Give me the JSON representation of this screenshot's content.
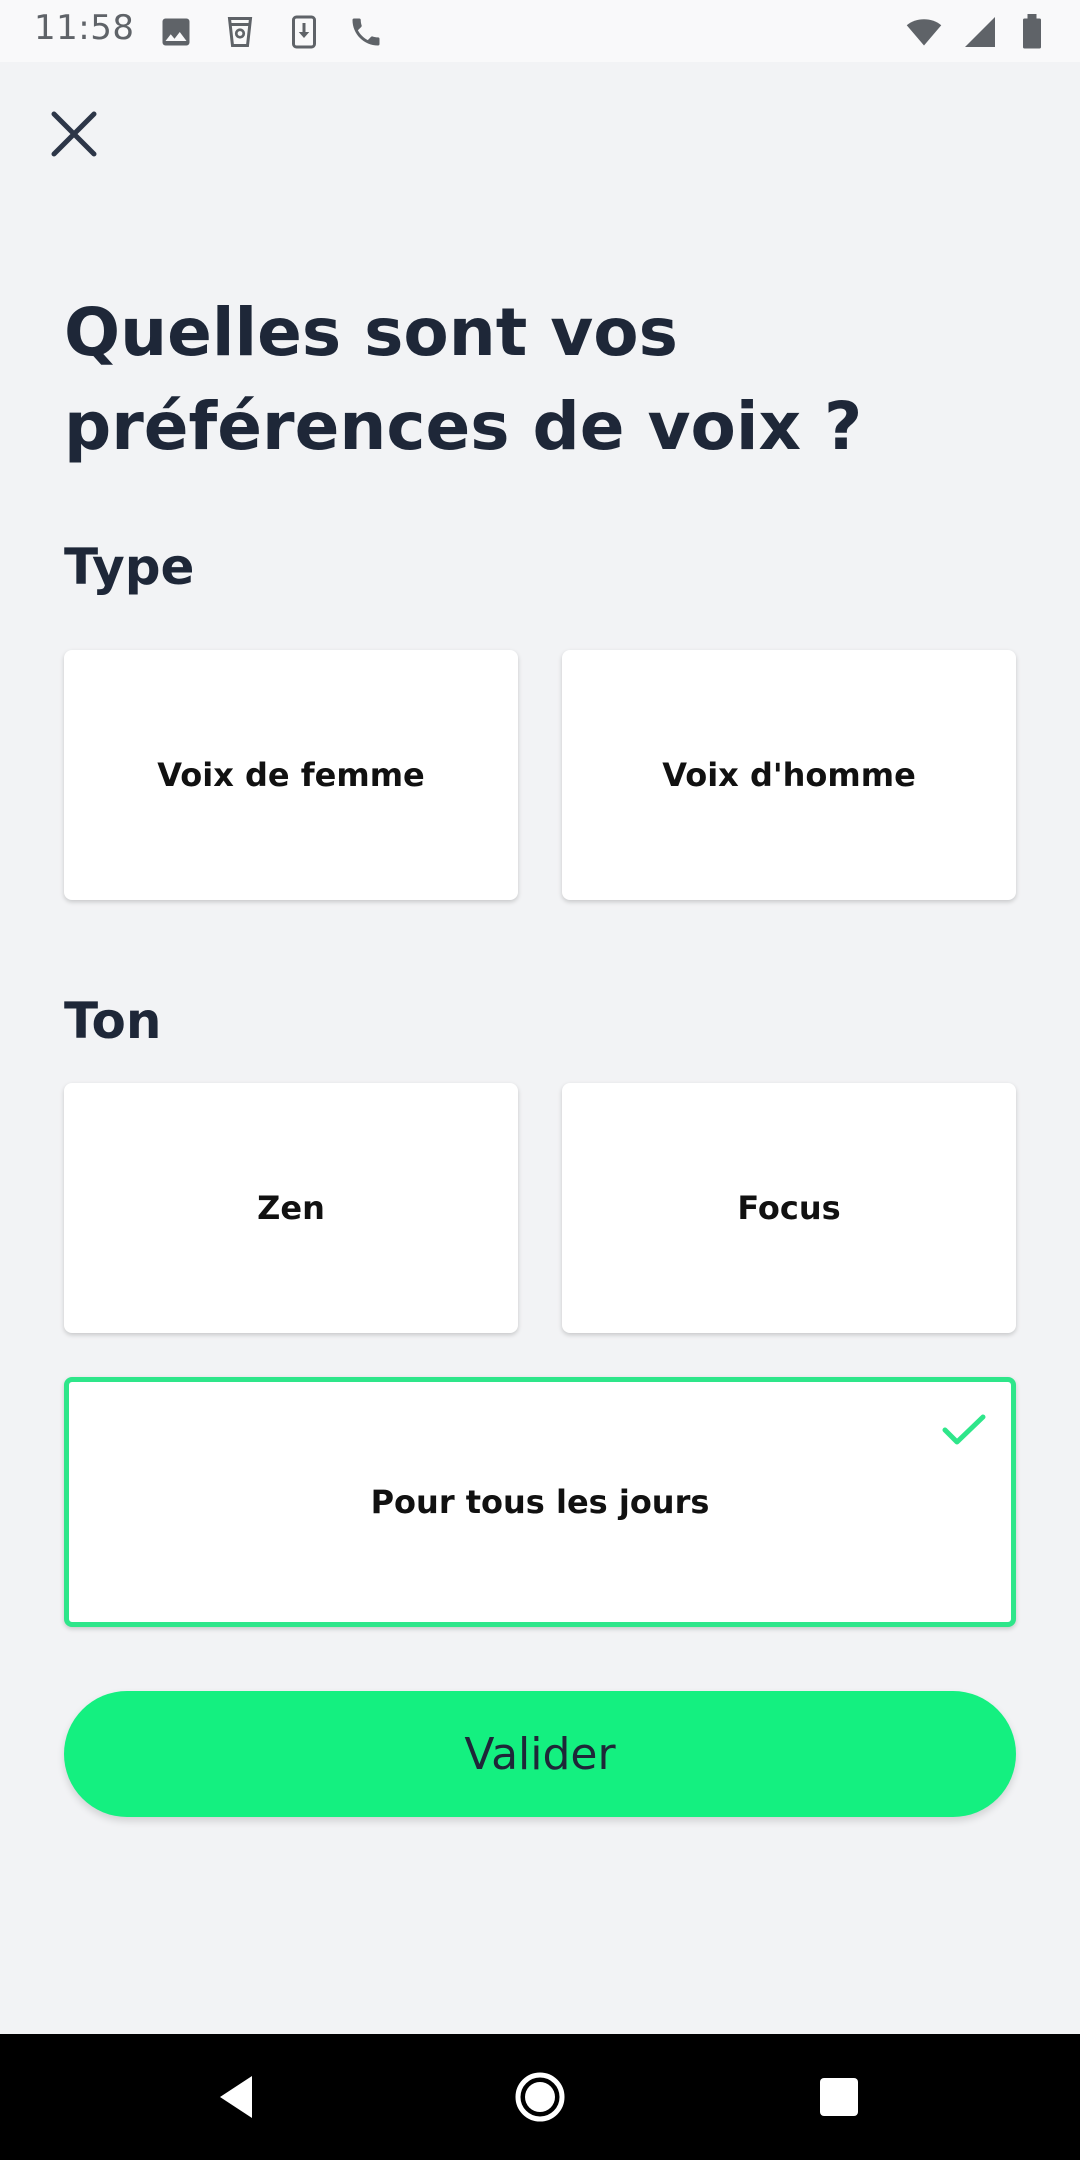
{
  "status_bar": {
    "time": "11:58",
    "left_icons": [
      "image-icon",
      "cup-icon",
      "download-icon",
      "phone-icon"
    ],
    "right_icons": [
      "wifi-icon",
      "signal-icon",
      "battery-icon"
    ]
  },
  "page": {
    "title": "Quelles sont vos préférences de voix ?"
  },
  "sections": {
    "type": {
      "label": "Type",
      "options": [
        "Voix de femme",
        "Voix d'homme"
      ]
    },
    "ton": {
      "label": "Ton",
      "options": [
        "Zen",
        "Focus",
        "Pour tous les jours"
      ],
      "selected": "Pour tous les jours"
    }
  },
  "actions": {
    "validate_label": "Valider"
  },
  "colors": {
    "accent": "#14f080",
    "selected_border": "#2ee68a",
    "text": "#1e2738",
    "background": "#f2f3f5"
  },
  "nav_bar": {
    "buttons": [
      "back-icon",
      "home-icon",
      "recents-icon"
    ]
  }
}
